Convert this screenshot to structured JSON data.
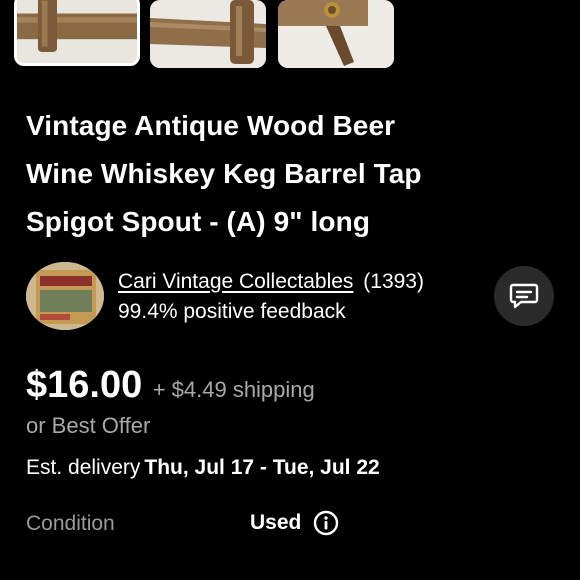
{
  "gallery": {
    "thumbnails": [
      {
        "name": "thumbnail-1",
        "selected": true
      },
      {
        "name": "thumbnail-2",
        "selected": false
      },
      {
        "name": "thumbnail-3",
        "selected": false
      }
    ]
  },
  "listing": {
    "title_line_1": "Vintage Antique Wood Beer",
    "title_line_2": "Wine Whiskey Keg Barrel Tap",
    "title_line_3": "Spigot Spout - (A) 9\" long"
  },
  "seller": {
    "name": "Cari Vintage Collectables",
    "feedback_count": "(1393)",
    "positive_feedback": "99.4% positive feedback",
    "avatar_icon": "seller-avatar",
    "chat_icon": "message-icon"
  },
  "pricing": {
    "price": "$16.00",
    "shipping": "+ $4.49 shipping",
    "best_offer": "or Best Offer"
  },
  "delivery": {
    "label": "Est. delivery",
    "dates": "Thu, Jul 17 - Tue, Jul 22"
  },
  "condition": {
    "label": "Condition",
    "value": "Used",
    "info_icon": "info-icon"
  },
  "colors": {
    "background": "#000000",
    "text": "#ffffff",
    "muted_text": "#a9a9a9",
    "chat_button_bg": "#2b2b2b"
  }
}
